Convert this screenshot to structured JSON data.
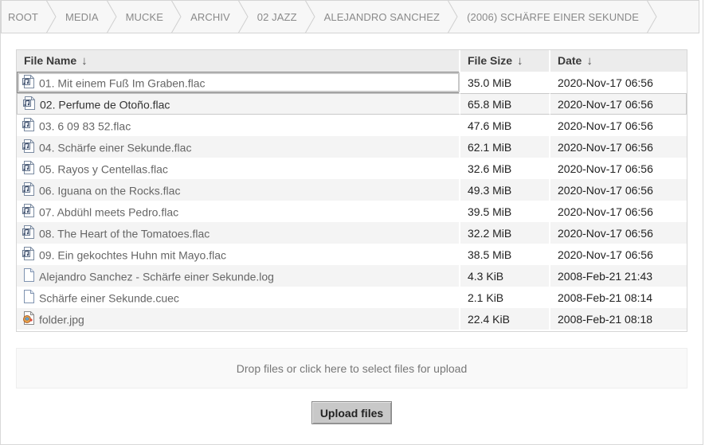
{
  "breadcrumb": [
    "ROOT",
    "MEDIA",
    "MUCKE",
    "ARCHIV",
    "02 JAZZ",
    "ALEJANDRO SANCHEZ",
    "(2006) SCHÄRFE EINER SEKUNDE"
  ],
  "table": {
    "headers": {
      "name": "File Name",
      "size": "File Size",
      "date": "Date",
      "sort_arrow": "↓"
    },
    "rows": [
      {
        "name": "01. Mit einem Fuß Im Graben.flac",
        "size": "35.0 MiB",
        "date": "2020-Nov-17 06:56",
        "icon": "audio-file-icon"
      },
      {
        "name": "02. Perfume de Otoño.flac",
        "size": "65.8 MiB",
        "date": "2020-Nov-17 06:56",
        "icon": "audio-file-icon"
      },
      {
        "name": "03. 6 09 83 52.flac",
        "size": "47.6 MiB",
        "date": "2020-Nov-17 06:56",
        "icon": "audio-file-icon"
      },
      {
        "name": "04. Schärfe einer Sekunde.flac",
        "size": "62.1 MiB",
        "date": "2020-Nov-17 06:56",
        "icon": "audio-file-icon"
      },
      {
        "name": "05. Rayos y Centellas.flac",
        "size": "32.6 MiB",
        "date": "2020-Nov-17 06:56",
        "icon": "audio-file-icon"
      },
      {
        "name": "06. Iguana on the Rocks.flac",
        "size": "49.3 MiB",
        "date": "2020-Nov-17 06:56",
        "icon": "audio-file-icon"
      },
      {
        "name": "07. Abdühl meets Pedro.flac",
        "size": "39.5 MiB",
        "date": "2020-Nov-17 06:56",
        "icon": "audio-file-icon"
      },
      {
        "name": "08. The Heart of the Tomatoes.flac",
        "size": "32.2 MiB",
        "date": "2020-Nov-17 06:56",
        "icon": "audio-file-icon"
      },
      {
        "name": "09. Ein gekochtes Huhn mit Mayo.flac",
        "size": "38.5 MiB",
        "date": "2020-Nov-17 06:56",
        "icon": "audio-file-icon"
      },
      {
        "name": "Alejandro Sanchez - Schärfe einer Sekunde.log",
        "size": "4.3 KiB",
        "date": "2008-Feb-21 21:43",
        "icon": "text-file-icon"
      },
      {
        "name": "Schärfe einer Sekunde.cuec",
        "size": "2.1 KiB",
        "date": "2008-Feb-21 08:14",
        "icon": "text-file-icon"
      },
      {
        "name": "folder.jpg",
        "size": "22.4 KiB",
        "date": "2008-Feb-21 08:18",
        "icon": "image-file-icon"
      }
    ]
  },
  "upload": {
    "dropzone_text": "Drop files or click here to select files for upload",
    "button_label": "Upload files"
  }
}
